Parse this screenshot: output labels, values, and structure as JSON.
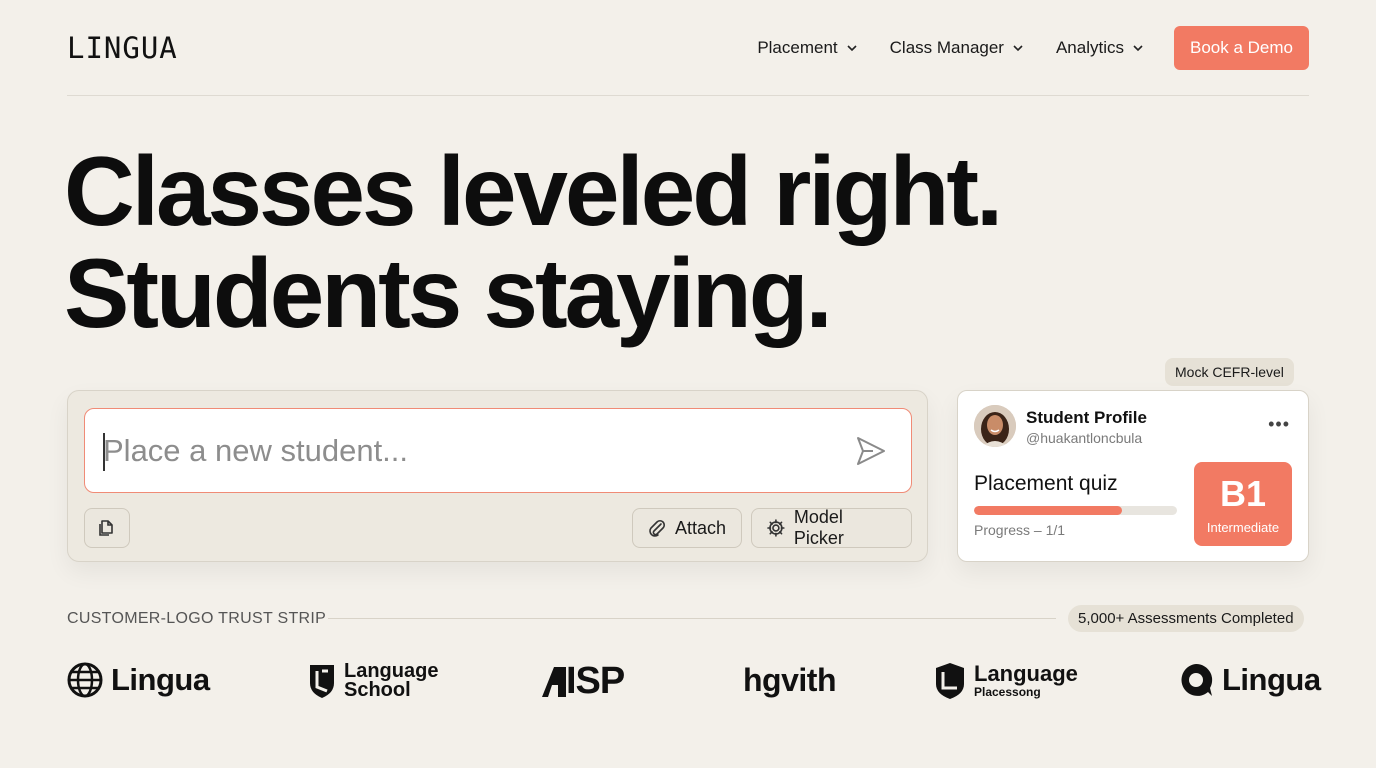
{
  "brand": {
    "logo": "LINGUA"
  },
  "nav": {
    "items": [
      {
        "label": "Placement",
        "icon": "chevron-down-icon"
      },
      {
        "label": "Class Manager",
        "icon": "chevron-down-icon"
      },
      {
        "label": "Analytics",
        "icon": "chevron-down-icon"
      }
    ],
    "cta_label": "Book a Demo"
  },
  "hero": {
    "line1": "Classes leveled right.",
    "line2": "Students staying."
  },
  "composer": {
    "placeholder": "Place a new student...",
    "attach_label": "Attach",
    "model_picker_label": "Model Picker",
    "icons": [
      "document-icon",
      "send-icon",
      "paperclip-icon",
      "gear-icon"
    ]
  },
  "mock_tag": "Mock CEFR-level",
  "profile_card": {
    "title": "Student Profile",
    "handle": "@huakantloncbula",
    "quiz_title": "Placement quiz",
    "progress_text": "Progress – 1/1",
    "progress_fraction": 0.73,
    "level_code": "B1",
    "level_name": "Intermediate"
  },
  "trust": {
    "label": "CUSTOMER-LOGO TRUST STRIP",
    "badge": "5,000+ Assessments Completed",
    "logos": [
      {
        "text": "Lingua",
        "icon": "globe-icon"
      },
      {
        "line1": "Language",
        "line2": "School",
        "icon": "shield-icon"
      },
      {
        "text": "ISP",
        "icon": "isp-mark-icon"
      },
      {
        "text": "hgvith"
      },
      {
        "line1": "Language",
        "line2": "Placessong",
        "icon": "shield-logo-icon"
      },
      {
        "text": "Lingua",
        "icon": "speech-bubble-icon"
      }
    ]
  },
  "colors": {
    "background": "#f3f0ea",
    "accent": "#f27a63",
    "text": "#111111"
  }
}
